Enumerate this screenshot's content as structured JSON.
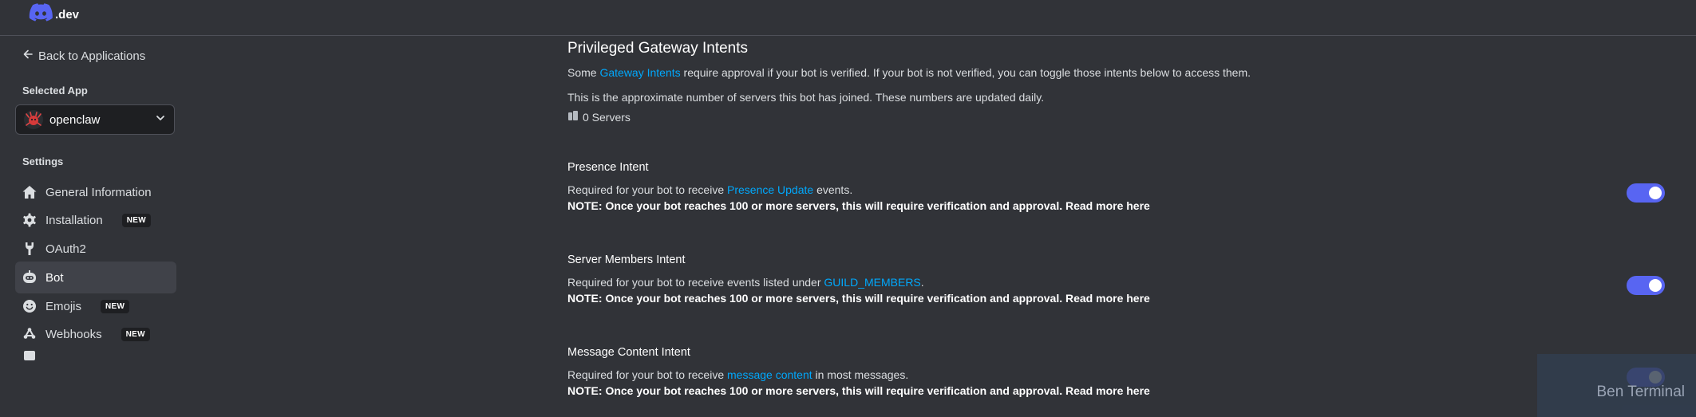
{
  "header": {
    "logo_text": ".dev",
    "logo_icon": "discord-logo-icon"
  },
  "sidebar": {
    "back_label": "Back to Applications",
    "selected_app_label": "Selected App",
    "selected_app_name": "openclaw",
    "settings_label": "Settings",
    "items": [
      {
        "label": "General Information",
        "icon": "home-icon",
        "badge": ""
      },
      {
        "label": "Installation",
        "icon": "gear-icon",
        "badge": "NEW"
      },
      {
        "label": "OAuth2",
        "icon": "wrench-icon",
        "badge": ""
      },
      {
        "label": "Bot",
        "icon": "bot-icon",
        "badge": "",
        "active": true
      },
      {
        "label": "Emojis",
        "icon": "smiley-icon",
        "badge": "NEW"
      },
      {
        "label": "Webhooks",
        "icon": "webhook-icon",
        "badge": "NEW"
      }
    ]
  },
  "main": {
    "title": "Privileged Gateway Intents",
    "intro_before": "Some ",
    "intro_link": "Gateway Intents",
    "intro_after": " require approval if your bot is verified. If your bot is not verified, you can toggle those intents below to access them.",
    "servers_note": "This is the approximate number of servers this bot has joined. These numbers are updated daily.",
    "server_count": "0 Servers",
    "intents": [
      {
        "title": "Presence Intent",
        "desc_before": "Required for your bot to receive ",
        "desc_link": "Presence Update",
        "desc_after": " events.",
        "note": "NOTE: Once your bot reaches 100 or more servers, this will require verification and approval.",
        "read_more": "Read more here",
        "enabled": true
      },
      {
        "title": "Server Members Intent",
        "desc_before": "Required for your bot to receive events listed under ",
        "desc_link": "GUILD_MEMBERS",
        "desc_after": ".",
        "note": "NOTE: Once your bot reaches 100 or more servers, this will require verification and approval.",
        "read_more": "Read more here",
        "enabled": true
      },
      {
        "title": "Message Content Intent",
        "desc_before": "Required for your bot to receive ",
        "desc_link": "message content",
        "desc_after": " in most messages.",
        "note": "NOTE: Once your bot reaches 100 or more servers, this will require verification and approval.",
        "read_more": "Read more here",
        "enabled": true
      }
    ]
  },
  "overlay": {
    "watermark_text": "Ben Terminal"
  },
  "colors": {
    "background": "#313338",
    "accent": "#5865f2",
    "link": "#00a8fc",
    "sidebar_active": "#404249"
  }
}
